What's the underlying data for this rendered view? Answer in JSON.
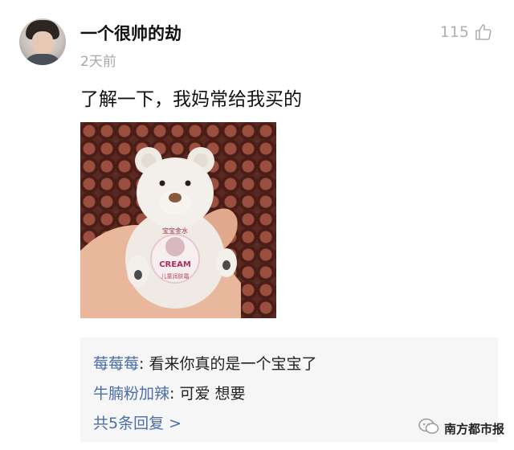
{
  "comment": {
    "username": "一个很帅的劫",
    "time": "2天前",
    "likes": "115",
    "text": "了解一下，我妈常给我买的",
    "image": {
      "label_top": "宝宝金水",
      "label_main": "CREAM",
      "label_sub": "儿童润肤霜"
    }
  },
  "replies": [
    {
      "author": "莓莓莓",
      "sep": ": ",
      "text": "看来你真的是一个宝宝了"
    },
    {
      "author": "牛腩粉加辣",
      "sep": ": ",
      "text": "可爱  想要"
    }
  ],
  "more_replies": "共5条回复 >",
  "watermark": "南方都市报",
  "colors": {
    "link": "#4b6ea8",
    "muted": "#a8a8a8",
    "reply_bg": "#f6f6f6"
  }
}
